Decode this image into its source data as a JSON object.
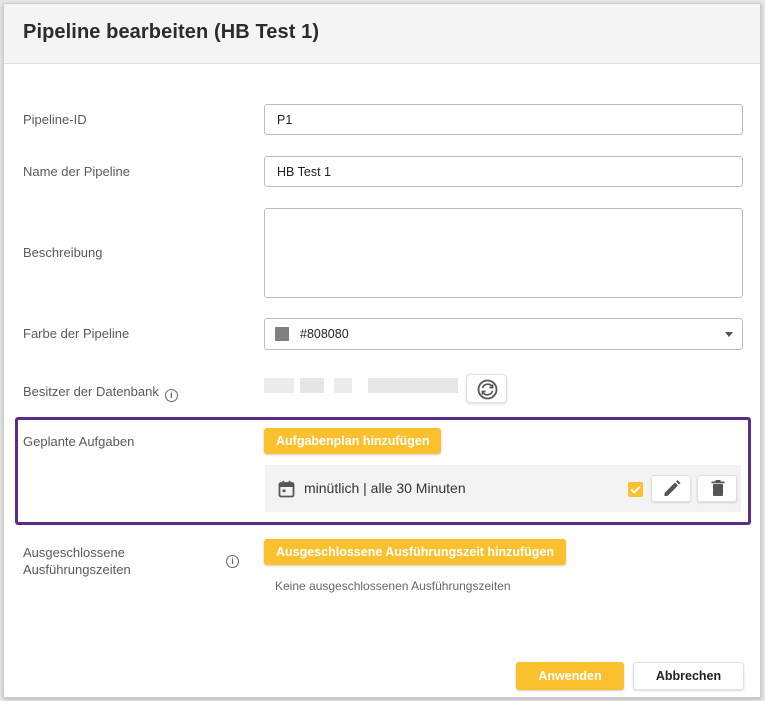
{
  "dialog": {
    "title": "Pipeline bearbeiten (HB Test 1)"
  },
  "form": {
    "pipeline_id": {
      "label": "Pipeline-ID",
      "value": "P1"
    },
    "name": {
      "label": "Name der Pipeline",
      "value": "HB Test 1"
    },
    "description": {
      "label": "Beschreibung",
      "value": ""
    },
    "color": {
      "label": "Farbe der Pipeline",
      "value": "#808080",
      "swatch": "#808080"
    },
    "owner": {
      "label": "Besitzer der Datenbank",
      "info_icon": "info-icon",
      "sync_icon": "sync-icon"
    },
    "scheduled": {
      "label": "Geplante Aufgaben",
      "add_label": "Aufgabenplan hinzufügen",
      "tasks": [
        {
          "icon": "calendar-icon",
          "text": "minütlich | alle 30 Minuten",
          "enabled": true
        }
      ]
    },
    "excluded": {
      "label": "Ausgeschlossene Ausführungszeiten",
      "info_icon": "info-icon",
      "add_label": "Ausgeschlossene Ausführungszeit hinzufügen",
      "empty_text": "Keine ausgeschlossenen Ausführungszeiten"
    }
  },
  "footer": {
    "apply_label": "Anwenden",
    "cancel_label": "Abbrechen"
  },
  "colors": {
    "accent": "#fbc02d",
    "highlight_border": "#5c2d86"
  }
}
